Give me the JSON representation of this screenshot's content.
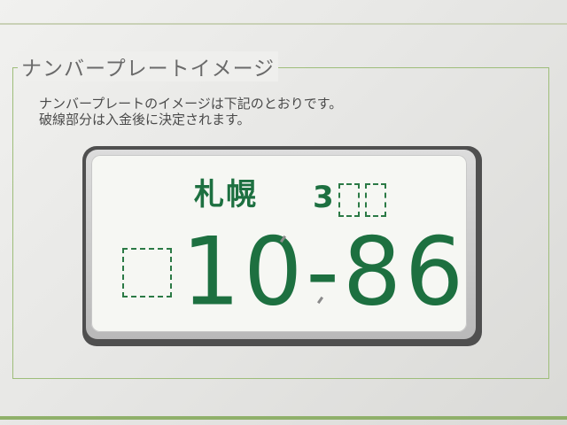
{
  "section": {
    "legend": "ナンバープレートイメージ",
    "description_line1": "ナンバープレートのイメージは下記のとおりです。",
    "description_line2": "破線部分は入金後に決定されます。"
  },
  "plate": {
    "region": "札幌",
    "class_digit": "3",
    "number": "10-86",
    "colors": {
      "text": "#1d7040",
      "plate_background": "#f6f7f3",
      "frame": "#4f4f4f"
    }
  }
}
